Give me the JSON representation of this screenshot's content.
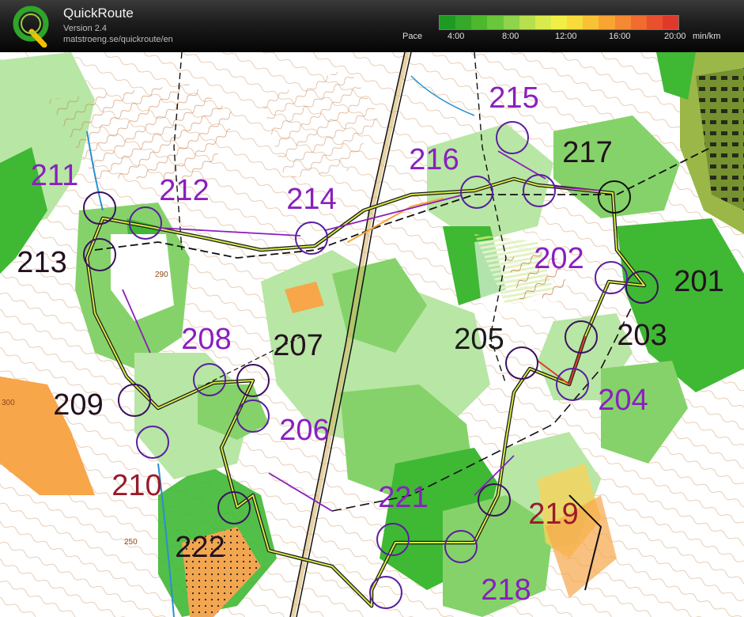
{
  "app": {
    "title": "QuickRoute",
    "version": "Version 2.4",
    "url": "matstroeng.se/quickroute/en"
  },
  "pace": {
    "label": "Pace",
    "ticks": [
      "4:00",
      "8:00",
      "12:00",
      "16:00",
      "20:00"
    ],
    "unit": "min/km",
    "colors": [
      "#1e9a22",
      "#36a82a",
      "#4cb82c",
      "#6ac63a",
      "#8fd44a",
      "#b6e04e",
      "#d8ea4c",
      "#f1ef46",
      "#f7dc3c",
      "#f9c236",
      "#f8a534",
      "#f58832",
      "#f06c30",
      "#e8502e",
      "#e0392c"
    ]
  },
  "map": {
    "colors": {
      "white_forest": "#ffffff",
      "green_light": "#b8e6a4",
      "green_mid": "#86d26a",
      "green_dark": "#3fb834",
      "open_orange": "#f7a64a",
      "yellow": "#f7d35a",
      "contour": "#b45c1c",
      "control": "#8a1fbf",
      "route": "#2a2a2a"
    },
    "controls": [
      {
        "code": "201",
        "color": "#23111e"
      },
      {
        "code": "202",
        "color": "#8a1fbf"
      },
      {
        "code": "203",
        "color": "#23111e"
      },
      {
        "code": "204",
        "color": "#8a1fbf"
      },
      {
        "code": "205",
        "color": "#1a1a1a"
      },
      {
        "code": "206",
        "color": "#8a1fbf"
      },
      {
        "code": "207",
        "color": "#23111e"
      },
      {
        "code": "208",
        "color": "#8a1fbf"
      },
      {
        "code": "209",
        "color": "#23111e"
      },
      {
        "code": "210",
        "color": "#9a1a2a"
      },
      {
        "code": "211",
        "color": "#8a1fbf"
      },
      {
        "code": "212",
        "color": "#8a1fbf"
      },
      {
        "code": "213",
        "color": "#23111e"
      },
      {
        "code": "214",
        "color": "#8a1fbf"
      },
      {
        "code": "215",
        "color": "#8a1fbf"
      },
      {
        "code": "216",
        "color": "#8a1fbf"
      },
      {
        "code": "217",
        "color": "#23111e"
      },
      {
        "code": "218",
        "color": "#8a1fbf"
      },
      {
        "code": "219",
        "color": "#9a1a2a"
      },
      {
        "code": "221",
        "color": "#8a1fbf"
      },
      {
        "code": "222",
        "color": "#23111e"
      }
    ],
    "contour_labels": [
      "290",
      "300",
      "250"
    ]
  }
}
